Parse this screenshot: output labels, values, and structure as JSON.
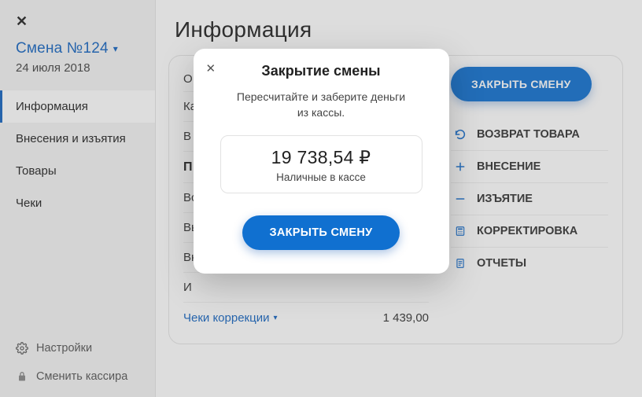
{
  "sidebar": {
    "close_label": "✕",
    "shift_title": "Смена №124",
    "shift_date": "24 июля 2018",
    "nav": [
      "Информация",
      "Внесения и изъятия",
      "Товары",
      "Чеки"
    ],
    "settings": "Настройки",
    "change_cashier": "Сменить кассира"
  },
  "main": {
    "title": "Информация",
    "left_rows": {
      "r0": "О",
      "r1": "Ка",
      "r2": "В",
      "section": "П",
      "r3": "Вс",
      "r4": "Вы",
      "r5": "Вн",
      "r6": "И",
      "correction_label": "Чеки коррекции",
      "correction_value": "1 439,00"
    },
    "actions": {
      "close_shift": "ЗАКРЫТЬ СМЕНУ",
      "return_goods": "ВОЗВРАТ ТОВАРА",
      "deposit": "ВНЕСЕНИЕ",
      "withdraw": "ИЗЪЯТИЕ",
      "correction": "КОРРЕКТИРОВКА",
      "reports": "ОТЧЕТЫ"
    }
  },
  "modal": {
    "title": "Закрытие смены",
    "subtitle": "Пересчитайте и заберите деньги из кассы.",
    "amount": "19 738,54 ₽",
    "amount_label": "Наличные в кассе",
    "confirm": "ЗАКРЫТЬ СМЕНУ"
  }
}
